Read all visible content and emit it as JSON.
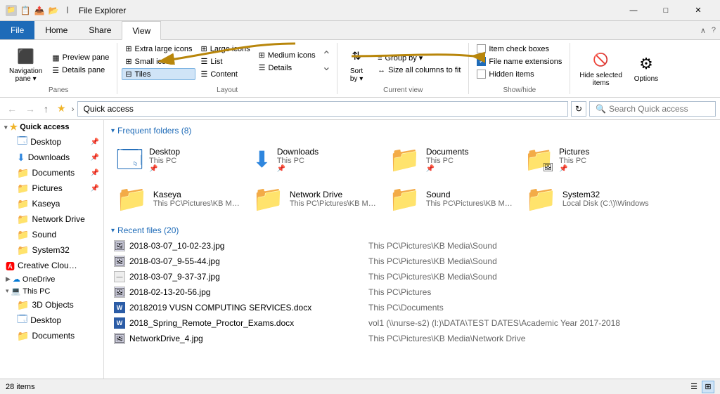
{
  "titlebar": {
    "title": "File Explorer",
    "minimize": "—",
    "maximize": "□",
    "close": "✕"
  },
  "ribbon": {
    "tabs": [
      "File",
      "Home",
      "Share",
      "View"
    ],
    "active_tab": "View",
    "panes_group": {
      "label": "Panes",
      "buttons": [
        {
          "id": "nav-pane",
          "label": "Navigation\npane"
        },
        {
          "id": "preview-pane",
          "label": "Preview pane"
        },
        {
          "id": "details-pane",
          "label": "Details pane"
        }
      ]
    },
    "layout_group": {
      "label": "Layout",
      "options": [
        "Extra large icons",
        "Large icons",
        "Medium icons",
        "Small icons",
        "List",
        "Details",
        "Tiles",
        "Content"
      ],
      "active": "Tiles"
    },
    "current_view_group": {
      "label": "Current view",
      "sort_by": "Sort by",
      "group_by": "Group by",
      "size_columns": "Size all columns to fit"
    },
    "show_hide_group": {
      "label": "Show/hide",
      "item_check_boxes": "Item check boxes",
      "file_name_extensions": "File name extensions",
      "hidden_items": "Hidden items",
      "file_name_extensions_checked": true,
      "hide_selected_items": "Hide selected\nitems"
    },
    "options_btn": "Options"
  },
  "navbar": {
    "path": "Quick access",
    "search_placeholder": "Search Quick access",
    "search_text": ""
  },
  "sidebar": {
    "quick_access": "Quick access",
    "items": [
      {
        "label": "Desktop",
        "indent": 1,
        "pin": true
      },
      {
        "label": "Downloads",
        "indent": 1,
        "pin": true
      },
      {
        "label": "Documents",
        "indent": 1,
        "pin": true
      },
      {
        "label": "Pictures",
        "indent": 1,
        "pin": true
      },
      {
        "label": "Kaseya",
        "indent": 1,
        "pin": false
      },
      {
        "label": "Network Drive",
        "indent": 1,
        "pin": false
      },
      {
        "label": "Sound",
        "indent": 1,
        "pin": false
      },
      {
        "label": "System32",
        "indent": 1,
        "pin": false
      }
    ],
    "creative_cloud": "Creative Cloud Fil",
    "onedrive": "OneDrive",
    "this_pc": "This PC",
    "this_pc_items": [
      "3D Objects",
      "Desktop",
      "Documents"
    ]
  },
  "content": {
    "frequent_folders_header": "Frequent folders (8)",
    "recent_files_header": "Recent files (20)",
    "frequent_folders": [
      {
        "name": "Desktop",
        "path": "This PC",
        "color": "blue"
      },
      {
        "name": "Downloads",
        "path": "This PC",
        "color": "download"
      },
      {
        "name": "Documents",
        "path": "This PC",
        "color": "yellow"
      },
      {
        "name": "Pictures",
        "path": "This PC",
        "color": "yellow"
      },
      {
        "name": "Kaseya",
        "path": "This PC\\Pictures\\KB Media",
        "color": "yellow"
      },
      {
        "name": "Network Drive",
        "path": "This PC\\Pictures\\KB Media",
        "color": "yellow"
      },
      {
        "name": "Sound",
        "path": "This PC\\Pictures\\KB Media",
        "color": "yellow"
      },
      {
        "name": "System32",
        "path": "Local Disk (C:\\)\\Windows",
        "color": "yellow"
      }
    ],
    "recent_files": [
      {
        "name": "2018-03-07_10-02-23.jpg",
        "path": "This PC\\Pictures\\KB Media\\Sound",
        "icon": "img"
      },
      {
        "name": "2018-03-07_9-55-44.jpg",
        "path": "This PC\\Pictures\\KB Media\\Sound",
        "icon": "img"
      },
      {
        "name": "2018-03-07_9-37-37.jpg",
        "path": "This PC\\Pictures\\KB Media\\Sound",
        "icon": "img"
      },
      {
        "name": "2018-02-13-20-56.jpg",
        "path": "This PC\\Pictures",
        "icon": "img"
      },
      {
        "name": "20182019 VUSN COMPUTING SERVICES.docx",
        "path": "This PC\\Documents",
        "icon": "word"
      },
      {
        "name": "2018_Spring_Remote_Proctor_Exams.docx",
        "path": "vol1 (\\\\nurse-s2) (l:)\\DATA\\TEST DATES\\Academic Year 2017-2018",
        "icon": "word"
      },
      {
        "name": "NetworkDrive_4.jpg",
        "path": "This PC\\Pictures\\KB Media\\Network Drive",
        "icon": "img"
      }
    ]
  },
  "statusbar": {
    "count": "28 items",
    "view_icons": [
      "list",
      "tiles"
    ]
  }
}
